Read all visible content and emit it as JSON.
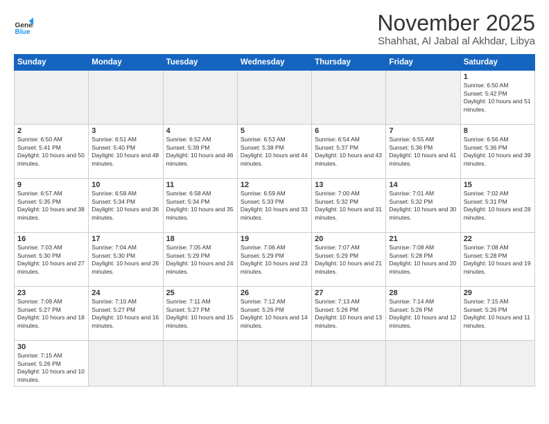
{
  "logo": {
    "general": "General",
    "blue": "Blue"
  },
  "title": "November 2025",
  "subtitle": "Shahhat, Al Jabal al Akhdar, Libya",
  "days_of_week": [
    "Sunday",
    "Monday",
    "Tuesday",
    "Wednesday",
    "Thursday",
    "Friday",
    "Saturday"
  ],
  "weeks": [
    [
      {
        "day": "",
        "info": ""
      },
      {
        "day": "",
        "info": ""
      },
      {
        "day": "",
        "info": ""
      },
      {
        "day": "",
        "info": ""
      },
      {
        "day": "",
        "info": ""
      },
      {
        "day": "",
        "info": ""
      },
      {
        "day": "1",
        "info": "Sunrise: 6:50 AM\nSunset: 5:42 PM\nDaylight: 10 hours and 51 minutes."
      }
    ],
    [
      {
        "day": "2",
        "info": "Sunrise: 6:50 AM\nSunset: 5:41 PM\nDaylight: 10 hours and 50 minutes."
      },
      {
        "day": "3",
        "info": "Sunrise: 6:51 AM\nSunset: 5:40 PM\nDaylight: 10 hours and 48 minutes."
      },
      {
        "day": "4",
        "info": "Sunrise: 6:52 AM\nSunset: 5:39 PM\nDaylight: 10 hours and 46 minutes."
      },
      {
        "day": "5",
        "info": "Sunrise: 6:53 AM\nSunset: 5:38 PM\nDaylight: 10 hours and 44 minutes."
      },
      {
        "day": "6",
        "info": "Sunrise: 6:54 AM\nSunset: 5:37 PM\nDaylight: 10 hours and 43 minutes."
      },
      {
        "day": "7",
        "info": "Sunrise: 6:55 AM\nSunset: 5:36 PM\nDaylight: 10 hours and 41 minutes."
      },
      {
        "day": "8",
        "info": "Sunrise: 6:56 AM\nSunset: 5:36 PM\nDaylight: 10 hours and 39 minutes."
      }
    ],
    [
      {
        "day": "9",
        "info": "Sunrise: 6:57 AM\nSunset: 5:35 PM\nDaylight: 10 hours and 38 minutes."
      },
      {
        "day": "10",
        "info": "Sunrise: 6:58 AM\nSunset: 5:34 PM\nDaylight: 10 hours and 36 minutes."
      },
      {
        "day": "11",
        "info": "Sunrise: 6:58 AM\nSunset: 5:34 PM\nDaylight: 10 hours and 35 minutes."
      },
      {
        "day": "12",
        "info": "Sunrise: 6:59 AM\nSunset: 5:33 PM\nDaylight: 10 hours and 33 minutes."
      },
      {
        "day": "13",
        "info": "Sunrise: 7:00 AM\nSunset: 5:32 PM\nDaylight: 10 hours and 31 minutes."
      },
      {
        "day": "14",
        "info": "Sunrise: 7:01 AM\nSunset: 5:32 PM\nDaylight: 10 hours and 30 minutes."
      },
      {
        "day": "15",
        "info": "Sunrise: 7:02 AM\nSunset: 5:31 PM\nDaylight: 10 hours and 28 minutes."
      }
    ],
    [
      {
        "day": "16",
        "info": "Sunrise: 7:03 AM\nSunset: 5:30 PM\nDaylight: 10 hours and 27 minutes."
      },
      {
        "day": "17",
        "info": "Sunrise: 7:04 AM\nSunset: 5:30 PM\nDaylight: 10 hours and 26 minutes."
      },
      {
        "day": "18",
        "info": "Sunrise: 7:05 AM\nSunset: 5:29 PM\nDaylight: 10 hours and 24 minutes."
      },
      {
        "day": "19",
        "info": "Sunrise: 7:06 AM\nSunset: 5:29 PM\nDaylight: 10 hours and 23 minutes."
      },
      {
        "day": "20",
        "info": "Sunrise: 7:07 AM\nSunset: 5:29 PM\nDaylight: 10 hours and 21 minutes."
      },
      {
        "day": "21",
        "info": "Sunrise: 7:08 AM\nSunset: 5:28 PM\nDaylight: 10 hours and 20 minutes."
      },
      {
        "day": "22",
        "info": "Sunrise: 7:08 AM\nSunset: 5:28 PM\nDaylight: 10 hours and 19 minutes."
      }
    ],
    [
      {
        "day": "23",
        "info": "Sunrise: 7:09 AM\nSunset: 5:27 PM\nDaylight: 10 hours and 18 minutes."
      },
      {
        "day": "24",
        "info": "Sunrise: 7:10 AM\nSunset: 5:27 PM\nDaylight: 10 hours and 16 minutes."
      },
      {
        "day": "25",
        "info": "Sunrise: 7:11 AM\nSunset: 5:27 PM\nDaylight: 10 hours and 15 minutes."
      },
      {
        "day": "26",
        "info": "Sunrise: 7:12 AM\nSunset: 5:26 PM\nDaylight: 10 hours and 14 minutes."
      },
      {
        "day": "27",
        "info": "Sunrise: 7:13 AM\nSunset: 5:26 PM\nDaylight: 10 hours and 13 minutes."
      },
      {
        "day": "28",
        "info": "Sunrise: 7:14 AM\nSunset: 5:26 PM\nDaylight: 10 hours and 12 minutes."
      },
      {
        "day": "29",
        "info": "Sunrise: 7:15 AM\nSunset: 5:26 PM\nDaylight: 10 hours and 11 minutes."
      }
    ],
    [
      {
        "day": "30",
        "info": "Sunrise: 7:15 AM\nSunset: 5:26 PM\nDaylight: 10 hours and 10 minutes."
      },
      {
        "day": "",
        "info": ""
      },
      {
        "day": "",
        "info": ""
      },
      {
        "day": "",
        "info": ""
      },
      {
        "day": "",
        "info": ""
      },
      {
        "day": "",
        "info": ""
      },
      {
        "day": "",
        "info": ""
      }
    ]
  ]
}
